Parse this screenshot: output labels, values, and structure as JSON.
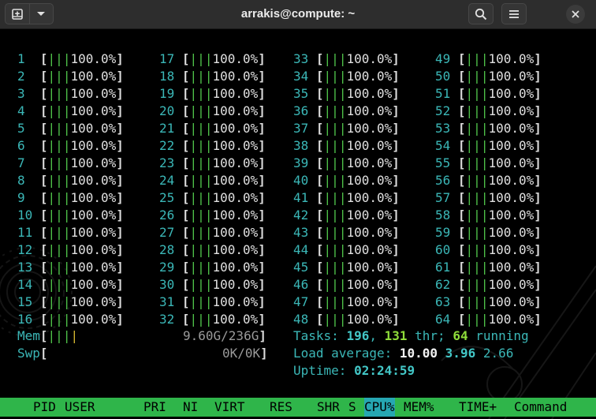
{
  "window": {
    "title": "arrakis@compute: ~",
    "icons": [
      "new-tab-icon",
      "chevron-down-icon",
      "search-icon",
      "hamburger-menu-icon",
      "close-icon"
    ]
  },
  "cpus": [
    {
      "id": "1",
      "bar": "|||",
      "pct": "100.0%"
    },
    {
      "id": "2",
      "bar": "|||",
      "pct": "100.0%"
    },
    {
      "id": "3",
      "bar": "|||",
      "pct": "100.0%"
    },
    {
      "id": "4",
      "bar": "|||",
      "pct": "100.0%"
    },
    {
      "id": "5",
      "bar": "|||",
      "pct": "100.0%"
    },
    {
      "id": "6",
      "bar": "|||",
      "pct": "100.0%"
    },
    {
      "id": "7",
      "bar": "|||",
      "pct": "100.0%"
    },
    {
      "id": "8",
      "bar": "|||",
      "pct": "100.0%"
    },
    {
      "id": "9",
      "bar": "|||",
      "pct": "100.0%"
    },
    {
      "id": "10",
      "bar": "|||",
      "pct": "100.0%"
    },
    {
      "id": "11",
      "bar": "|||",
      "pct": "100.0%"
    },
    {
      "id": "12",
      "bar": "|||",
      "pct": "100.0%"
    },
    {
      "id": "13",
      "bar": "|||",
      "pct": "100.0%"
    },
    {
      "id": "14",
      "bar": "|||",
      "pct": "100.0%"
    },
    {
      "id": "15",
      "bar": "|||",
      "pct": "100.0%"
    },
    {
      "id": "16",
      "bar": "|||",
      "pct": "100.0%"
    },
    {
      "id": "17",
      "bar": "|||",
      "pct": "100.0%"
    },
    {
      "id": "18",
      "bar": "|||",
      "pct": "100.0%"
    },
    {
      "id": "19",
      "bar": "|||",
      "pct": "100.0%"
    },
    {
      "id": "20",
      "bar": "|||",
      "pct": "100.0%"
    },
    {
      "id": "21",
      "bar": "|||",
      "pct": "100.0%"
    },
    {
      "id": "22",
      "bar": "|||",
      "pct": "100.0%"
    },
    {
      "id": "23",
      "bar": "|||",
      "pct": "100.0%"
    },
    {
      "id": "24",
      "bar": "|||",
      "pct": "100.0%"
    },
    {
      "id": "25",
      "bar": "|||",
      "pct": "100.0%"
    },
    {
      "id": "26",
      "bar": "|||",
      "pct": "100.0%"
    },
    {
      "id": "27",
      "bar": "|||",
      "pct": "100.0%"
    },
    {
      "id": "28",
      "bar": "|||",
      "pct": "100.0%"
    },
    {
      "id": "29",
      "bar": "|||",
      "pct": "100.0%"
    },
    {
      "id": "30",
      "bar": "|||",
      "pct": "100.0%"
    },
    {
      "id": "31",
      "bar": "|||",
      "pct": "100.0%"
    },
    {
      "id": "32",
      "bar": "|||",
      "pct": "100.0%"
    },
    {
      "id": "33",
      "bar": "|||",
      "pct": "100.0%"
    },
    {
      "id": "34",
      "bar": "|||",
      "pct": "100.0%"
    },
    {
      "id": "35",
      "bar": "|||",
      "pct": "100.0%"
    },
    {
      "id": "36",
      "bar": "|||",
      "pct": "100.0%"
    },
    {
      "id": "37",
      "bar": "|||",
      "pct": "100.0%"
    },
    {
      "id": "38",
      "bar": "|||",
      "pct": "100.0%"
    },
    {
      "id": "39",
      "bar": "|||",
      "pct": "100.0%"
    },
    {
      "id": "40",
      "bar": "|||",
      "pct": "100.0%"
    },
    {
      "id": "41",
      "bar": "|||",
      "pct": "100.0%"
    },
    {
      "id": "42",
      "bar": "|||",
      "pct": "100.0%"
    },
    {
      "id": "43",
      "bar": "|||",
      "pct": "100.0%"
    },
    {
      "id": "44",
      "bar": "|||",
      "pct": "100.0%"
    },
    {
      "id": "45",
      "bar": "|||",
      "pct": "100.0%"
    },
    {
      "id": "46",
      "bar": "|||",
      "pct": "100.0%"
    },
    {
      "id": "47",
      "bar": "|||",
      "pct": "100.0%"
    },
    {
      "id": "48",
      "bar": "|||",
      "pct": "100.0%"
    },
    {
      "id": "49",
      "bar": "|||",
      "pct": "100.0%"
    },
    {
      "id": "50",
      "bar": "|||",
      "pct": "100.0%"
    },
    {
      "id": "51",
      "bar": "|||",
      "pct": "100.0%"
    },
    {
      "id": "52",
      "bar": "|||",
      "pct": "100.0%"
    },
    {
      "id": "53",
      "bar": "|||",
      "pct": "100.0%"
    },
    {
      "id": "54",
      "bar": "|||",
      "pct": "100.0%"
    },
    {
      "id": "55",
      "bar": "|||",
      "pct": "100.0%"
    },
    {
      "id": "56",
      "bar": "|||",
      "pct": "100.0%"
    },
    {
      "id": "57",
      "bar": "|||",
      "pct": "100.0%"
    },
    {
      "id": "58",
      "bar": "|||",
      "pct": "100.0%"
    },
    {
      "id": "59",
      "bar": "|||",
      "pct": "100.0%"
    },
    {
      "id": "60",
      "bar": "|||",
      "pct": "100.0%"
    },
    {
      "id": "61",
      "bar": "|||",
      "pct": "100.0%"
    },
    {
      "id": "62",
      "bar": "|||",
      "pct": "100.0%"
    },
    {
      "id": "63",
      "bar": "|||",
      "pct": "100.0%"
    },
    {
      "id": "64",
      "bar": "|||",
      "pct": "100.0%"
    }
  ],
  "mem": {
    "label": "Mem",
    "bar_green": "|||",
    "bar_yellow": "|",
    "value": "9.60G/236G"
  },
  "swp": {
    "label": "Swp",
    "value": "0K/0K"
  },
  "tasks": {
    "label": "Tasks: ",
    "count": "196",
    "sep": ", ",
    "threads": "131",
    "thr_label": " thr; ",
    "running": "64",
    "running_label": " running"
  },
  "load": {
    "label": "Load average: ",
    "l1": "10.00",
    "l5": "3.96",
    "l15": "2.66"
  },
  "uptime": {
    "label": "Uptime: ",
    "value": "02:24:59"
  },
  "columns": {
    "pid": "PID",
    "user": "USER",
    "pri": "PRI",
    "ni": "NI",
    "virt": "VIRT",
    "res": "RES",
    "shr": "SHR",
    "s": "S",
    "cpu": "CPU%",
    "mem": "MEM%",
    "time": "TIME+",
    "command": "Command"
  },
  "colors": {
    "bar": "#4fc34a",
    "cpu_id": "#3bb7b7",
    "header_bg": "#2fb54a",
    "sorted_col": "#26a7b2"
  }
}
